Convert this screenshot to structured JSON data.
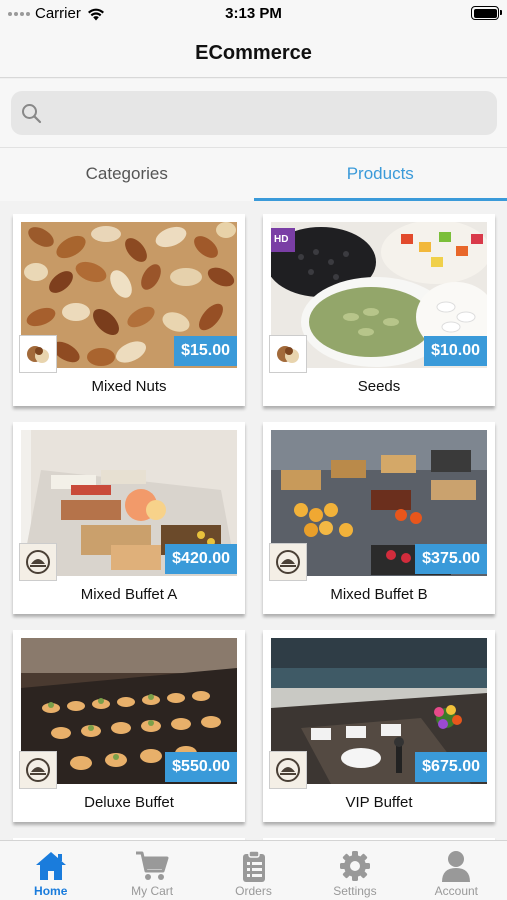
{
  "status_bar": {
    "carrier": "Carrier",
    "time": "3:13 PM"
  },
  "nav": {
    "title": "ECommerce"
  },
  "search": {
    "placeholder": "",
    "value": ""
  },
  "tabs": [
    {
      "label": "Categories",
      "active": false
    },
    {
      "label": "Products",
      "active": true
    }
  ],
  "products": [
    {
      "name": "Mixed Nuts",
      "price": "$15.00",
      "image": "mixed-nuts-photo"
    },
    {
      "name": "Seeds",
      "price": "$10.00",
      "image": "seeds-photo"
    },
    {
      "name": "Mixed Buffet A",
      "price": "$420.00",
      "image": "buffet-a-photo"
    },
    {
      "name": "Mixed Buffet B",
      "price": "$375.00",
      "image": "buffet-b-photo"
    },
    {
      "name": "Deluxe Buffet",
      "price": "$550.00",
      "image": "deluxe-buffet-photo"
    },
    {
      "name": "VIP Buffet",
      "price": "$675.00",
      "image": "vip-buffet-photo"
    }
  ],
  "tab_bar": [
    {
      "label": "Home",
      "icon": "home-icon",
      "active": true
    },
    {
      "label": "My Cart",
      "icon": "cart-icon",
      "active": false
    },
    {
      "label": "Orders",
      "icon": "clipboard-icon",
      "active": false
    },
    {
      "label": "Settings",
      "icon": "gear-icon",
      "active": false
    },
    {
      "label": "Account",
      "icon": "person-icon",
      "active": false
    }
  ],
  "colors": {
    "accent": "#3a9ad9",
    "tabbar_active": "#1a7cdc",
    "inactive": "#999999"
  }
}
